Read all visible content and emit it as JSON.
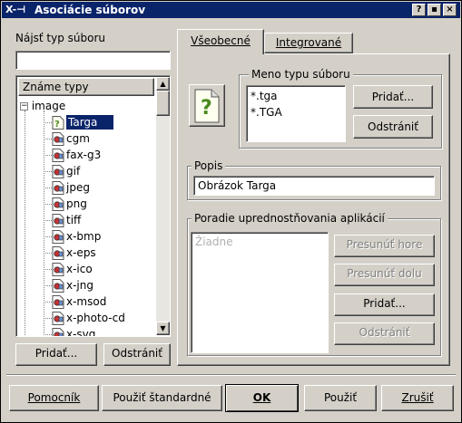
{
  "window": {
    "title": "Asociácie súborov",
    "help_label": "?",
    "maximize_label": "▪",
    "close_label": "×"
  },
  "left": {
    "find_label": "Nájsť typ súboru",
    "find_value": "",
    "tree_header": "Známe typy",
    "tree_root": "image",
    "tree_items": [
      "Targa",
      "cgm",
      "fax-g3",
      "gif",
      "jpeg",
      "png",
      "tiff",
      "x-bmp",
      "x-eps",
      "x-ico",
      "x-jng",
      "x-msod",
      "x-photo-cd",
      "x-svg"
    ],
    "add_label": "Pridať...",
    "remove_label": "Odstrániť"
  },
  "tabs": {
    "general_label": "Všeobecné",
    "embedded_label": "Integrované"
  },
  "general": {
    "patterns_group": "Meno typu súboru",
    "patterns": [
      "*.tga",
      "*.TGA"
    ],
    "add_pattern_label": "Pridať...",
    "remove_pattern_label": "Odstrániť",
    "description_group": "Popis",
    "description_value": "Obrázok Targa",
    "apps_group": "Poradie uprednostňovania aplikácií",
    "apps_empty": "Žiadne",
    "move_up_label": "Presunúť hore",
    "move_down_label": "Presunúť dolu",
    "add_app_label": "Pridať...",
    "remove_app_label": "Odstrániť"
  },
  "footer": {
    "help_label": "Pomocník",
    "defaults_label": "Použiť štandardné",
    "ok_label": "OK",
    "apply_label": "Použiť",
    "cancel_label": "Zrušiť"
  },
  "colors": {
    "titlebar": "#0a246a",
    "selection": "#0a246a",
    "face": "#d4d0c8"
  }
}
